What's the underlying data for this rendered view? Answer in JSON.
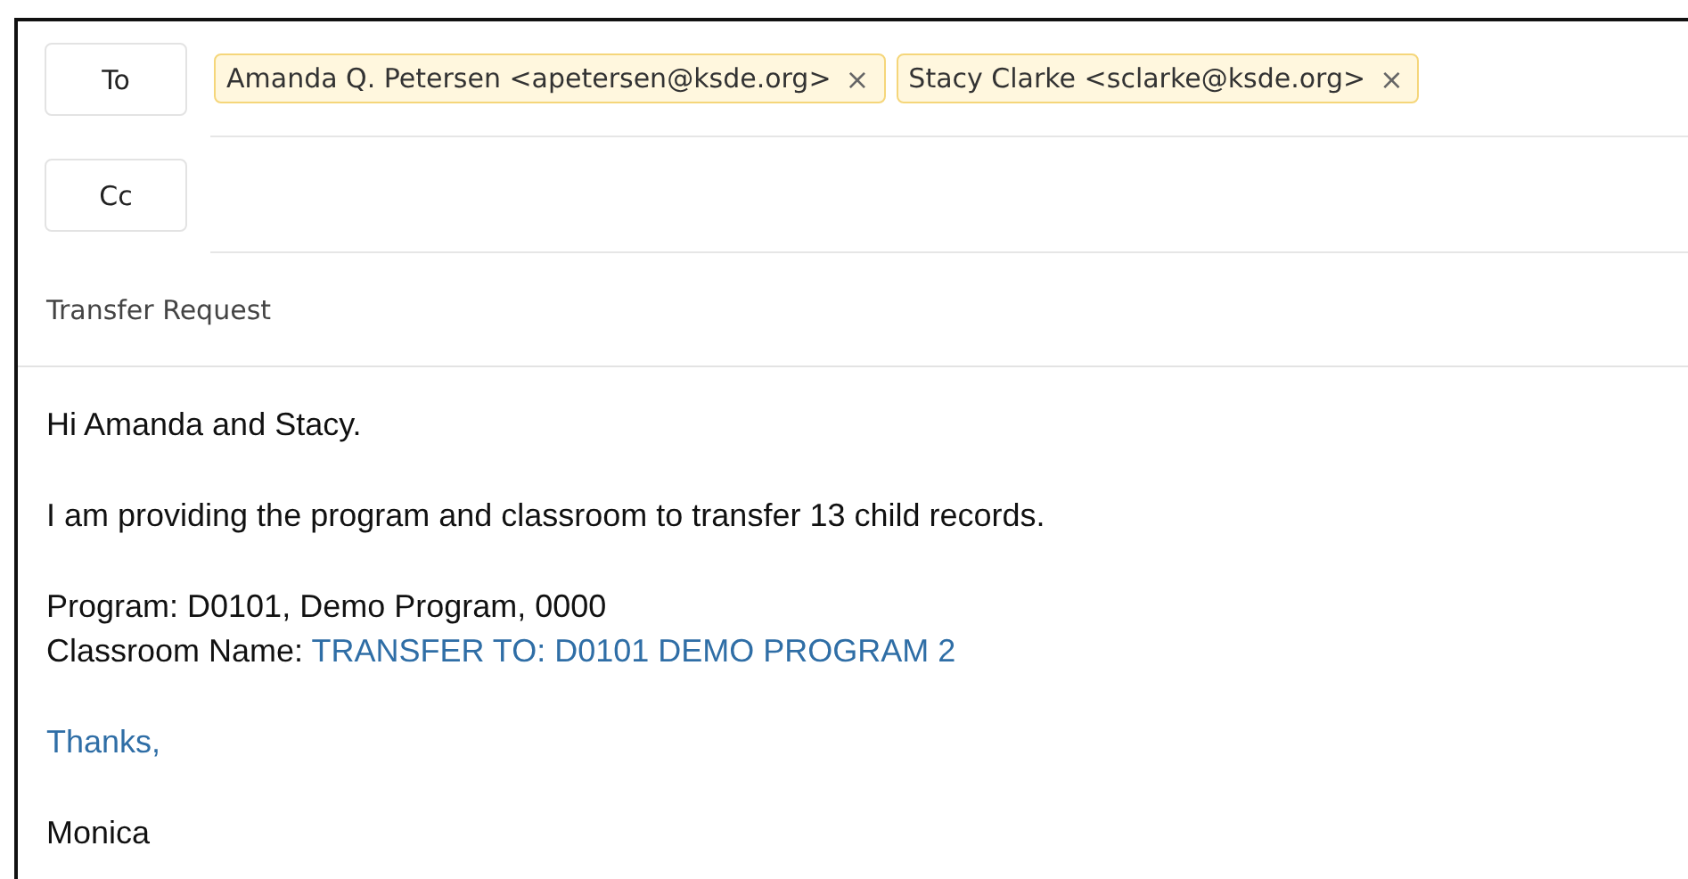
{
  "recipients": {
    "to": {
      "label": "To",
      "chips": [
        {
          "text": "Amanda Q. Petersen <apetersen@ksde.org>",
          "remove": "×"
        },
        {
          "text": "Stacy Clarke <sclarke@ksde.org>",
          "remove": "×"
        }
      ]
    },
    "cc": {
      "label": "Cc"
    }
  },
  "subject": "Transfer Request",
  "body": [
    {
      "lines": [
        [
          {
            "text": "Hi Amanda and Stacy.",
            "kind": "plain"
          }
        ]
      ]
    },
    {
      "lines": [
        [
          {
            "text": "I am providing the program and classroom to transfer 13 child records.",
            "kind": "plain"
          }
        ]
      ]
    },
    {
      "lines": [
        [
          {
            "text": "Program: D0101, Demo Program, 0000",
            "kind": "plain"
          }
        ],
        [
          {
            "text": "Classroom Name: ",
            "kind": "plain"
          },
          {
            "text": "TRANSFER TO: D0101 DEMO PROGRAM 2",
            "kind": "accent"
          }
        ]
      ]
    },
    {
      "lines": [
        [
          {
            "text": "Thanks,",
            "kind": "accent"
          }
        ]
      ]
    },
    {
      "lines": [
        [
          {
            "text": "Monica",
            "kind": "plain"
          }
        ]
      ]
    }
  ]
}
